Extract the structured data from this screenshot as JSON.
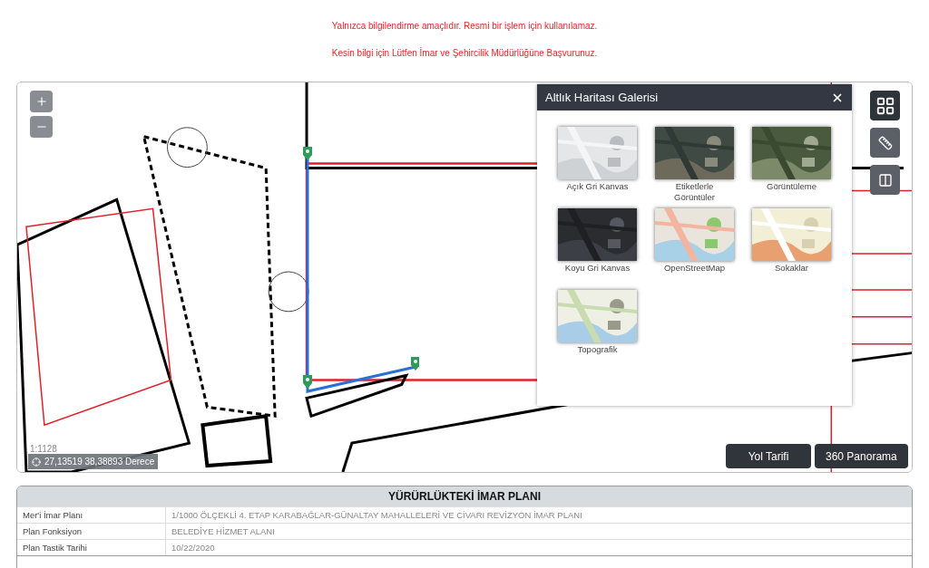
{
  "notices": [
    "Yalnızca bilgilendirme amaçlıdır. Resmi bir işlem için kullanılamaz.",
    "Kesin bilgi için Lütfen İmar ve Şehircilik Müdürlüğüne Başvurunuz."
  ],
  "map": {
    "scale": "1:1128",
    "coordinates": "27,13519 38,38893 Derece",
    "buttons": [
      "Yol Tarifi",
      "360 Panorama"
    ],
    "tools": [
      {
        "kind": "gallery",
        "selected": true
      },
      {
        "kind": "measure",
        "selected": false
      },
      {
        "kind": "compare",
        "selected": false
      }
    ]
  },
  "basemap_gallery": {
    "title": "Altlık Haritası Galerisi",
    "items": [
      {
        "label": "Açık Gri Kanvas"
      },
      {
        "label": "Etiketlerle Görüntüler"
      },
      {
        "label": "Görüntüleme"
      },
      {
        "label": "Koyu Gri Kanvas"
      },
      {
        "label": "OpenStreetMap"
      },
      {
        "label": "Sokaklar"
      },
      {
        "label": "Topografik"
      }
    ]
  },
  "plan_table": {
    "title": "YÜRÜRLÜKTEKİ İMAR PLANI",
    "rows": [
      {
        "label": "Mer'i İmar Planı",
        "value": "1/1000 ÖLÇEKLİ 4. ETAP KARABAĞLAR-GÜNALTAY MAHALLELERİ VE CİVARI REVİZYON İMAR PLANI"
      },
      {
        "label": "Plan Fonksiyon",
        "value": "BELEDİYE HİZMET ALANI"
      },
      {
        "label": "Plan Tastik Tarihi",
        "value": "10/22/2020"
      }
    ]
  }
}
